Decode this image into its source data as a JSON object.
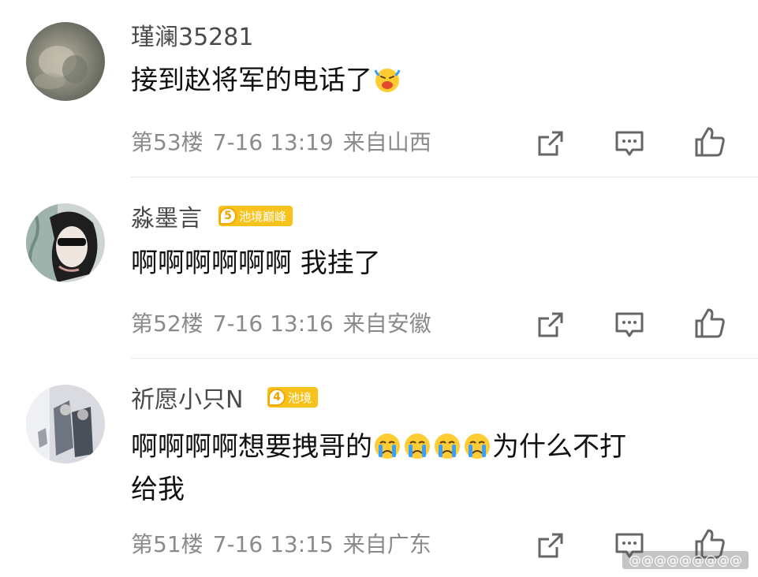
{
  "comments": [
    {
      "username": "瑾澜35281",
      "badge": null,
      "text_parts": [
        "接到赵将军的电话了"
      ],
      "emoji": "laugh-cry-emoji",
      "floor": "第53楼",
      "time": "7-16 13:19",
      "location": "来自山西"
    },
    {
      "username": "淼墨言",
      "badge": {
        "level": "5",
        "label": "池境巅峰"
      },
      "text_parts": [
        "啊啊啊啊啊啊 我挂了"
      ],
      "floor": "第52楼",
      "time": "7-16 13:16",
      "location": "来自安徽"
    },
    {
      "username": "祈愿小只N",
      "badge": {
        "level": "4",
        "label": "池境"
      },
      "text_parts": [
        "啊啊啊啊想要拽哥的",
        "为什么不打",
        "给我"
      ],
      "emoji": "crying-emoji",
      "floor": "第51楼",
      "time": "7-16 13:15",
      "location": "来自广东"
    }
  ],
  "icons": {
    "share": "share-icon",
    "reply": "comment-icon",
    "like": "like-icon"
  },
  "watermark": "@@@@@@@@@"
}
